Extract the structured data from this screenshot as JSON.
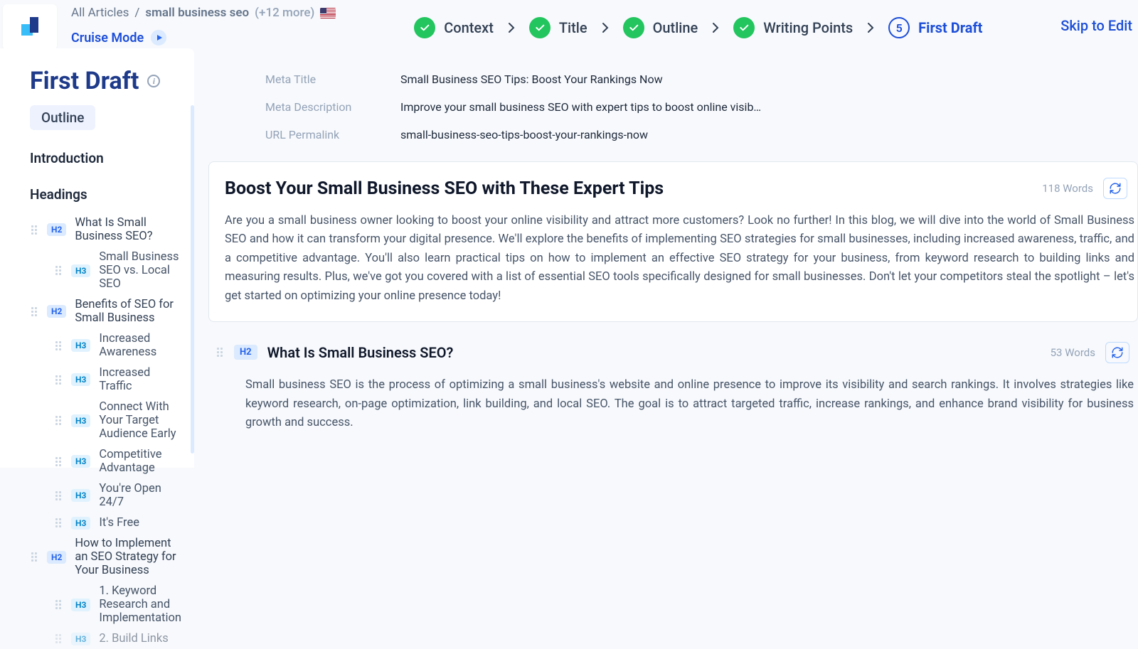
{
  "breadcrumb": {
    "root": "All Articles",
    "sep": "/",
    "current": "small business seo",
    "more": "(+12 more)"
  },
  "cruise": {
    "label": "Cruise Mode"
  },
  "steps": {
    "items": [
      {
        "label": "Context",
        "done": true
      },
      {
        "label": "Title",
        "done": true
      },
      {
        "label": "Outline",
        "done": true
      },
      {
        "label": "Writing Points",
        "done": true
      },
      {
        "label": "First Draft",
        "num": "5",
        "current": true
      }
    ]
  },
  "skip": "Skip to Edit",
  "sidebar": {
    "title": "First Draft",
    "outline_chip": "Outline",
    "sections": {
      "intro": "Introduction",
      "headings": "Headings"
    },
    "tree": [
      {
        "lvl": "H2",
        "text": "What Is Small Business SEO?"
      },
      {
        "lvl": "H3",
        "text": "Small Business SEO vs. Local SEO"
      },
      {
        "lvl": "H2",
        "text": "Benefits of SEO for Small Business"
      },
      {
        "lvl": "H3",
        "text": "Increased Awareness"
      },
      {
        "lvl": "H3",
        "text": "Increased Traffic"
      },
      {
        "lvl": "H3",
        "text": "Connect With Your Target Audience Early"
      },
      {
        "lvl": "H3",
        "text": "Competitive Advantage"
      },
      {
        "lvl": "H3",
        "text": "You're Open 24/7"
      },
      {
        "lvl": "H3",
        "text": "It's Free"
      },
      {
        "lvl": "H2",
        "text": "How to Implement an SEO Strategy for Your Business"
      },
      {
        "lvl": "H3",
        "text": "1. Keyword Research and Implementation"
      },
      {
        "lvl": "H3",
        "text": "2. Build Links"
      }
    ]
  },
  "meta": {
    "rows": [
      {
        "key": "Meta Title",
        "val": "Small Business SEO Tips: Boost Your Rankings Now"
      },
      {
        "key": "Meta Description",
        "val": "Improve your small business SEO with expert tips to boost online visib…"
      },
      {
        "key": "URL Permalink",
        "val": "small-business-seo-tips-boost-your-rankings-now"
      }
    ]
  },
  "article": {
    "title": "Boost Your Small Business SEO with These Expert Tips",
    "word_count": "118 Words",
    "intro": "Are you a small business owner looking to boost your online visibility and attract more customers? Look no further! In this blog, we will dive into the world of Small Business SEO and how it can transform your digital presence. We'll explore the benefits of implementing SEO strategies for small businesses, including increased awareness, traffic, and a competitive advantage. You'll also learn practical tips on how to implement an effective SEO strategy for your business, from keyword research to building links and measuring results. Plus, we've got you covered with a list of essential SEO tools specifically designed for small businesses. Don't let your competitors steal the spotlight – let's get started on optimizing your online presence today!"
  },
  "section": {
    "badge": "H2",
    "title": "What Is Small Business SEO?",
    "word_count": "53 Words",
    "body": "Small business SEO is the process of optimizing a small business's website and online presence to improve its visibility and search rankings. It involves strategies like keyword research, on-page optimization, link building, and local SEO. The goal is to attract targeted traffic, increase rankings, and enhance brand visibility for business growth and success."
  }
}
